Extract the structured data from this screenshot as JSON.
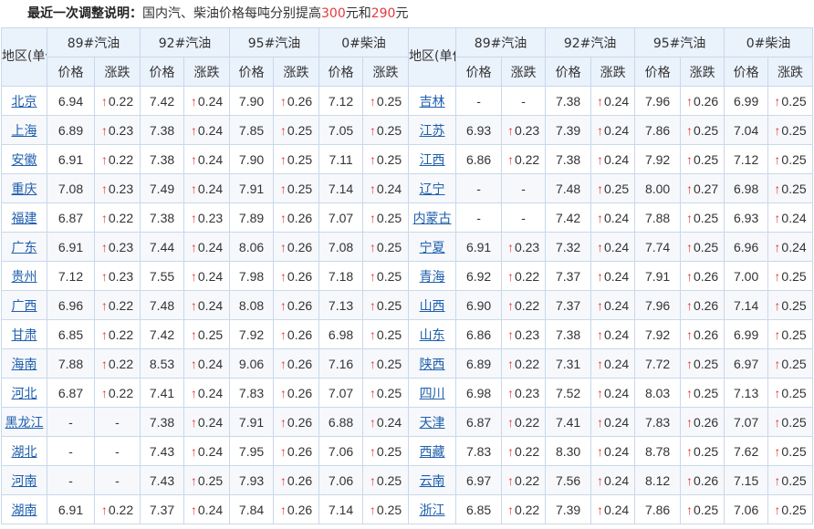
{
  "notice": {
    "label": "最近一次调整说明：",
    "text_pre": "国内汽、柴油价格每吨分别提高",
    "gas_amount": "300",
    "text_mid": "元和",
    "diesel_amount": "290",
    "text_post": "元"
  },
  "header": {
    "region": "地区(单位:元/升)",
    "fuels": [
      "89#汽油",
      "92#汽油",
      "95#汽油",
      "0#柴油"
    ],
    "price": "价格",
    "change": "涨跌",
    "up_arrow": "↑",
    "none": "-"
  },
  "rows": [
    {
      "left": {
        "region": "北京",
        "v": [
          [
            "6.94",
            "0.22"
          ],
          [
            "7.42",
            "0.24"
          ],
          [
            "7.90",
            "0.26"
          ],
          [
            "7.12",
            "0.25"
          ]
        ]
      },
      "right": {
        "region": "吉林",
        "v": [
          [
            "-",
            "-"
          ],
          [
            "7.38",
            "0.24"
          ],
          [
            "7.96",
            "0.26"
          ],
          [
            "6.99",
            "0.25"
          ]
        ]
      }
    },
    {
      "left": {
        "region": "上海",
        "v": [
          [
            "6.89",
            "0.23"
          ],
          [
            "7.38",
            "0.24"
          ],
          [
            "7.85",
            "0.25"
          ],
          [
            "7.05",
            "0.25"
          ]
        ]
      },
      "right": {
        "region": "江苏",
        "v": [
          [
            "6.93",
            "0.23"
          ],
          [
            "7.39",
            "0.24"
          ],
          [
            "7.86",
            "0.25"
          ],
          [
            "7.04",
            "0.25"
          ]
        ]
      }
    },
    {
      "left": {
        "region": "安徽",
        "v": [
          [
            "6.91",
            "0.22"
          ],
          [
            "7.38",
            "0.24"
          ],
          [
            "7.90",
            "0.25"
          ],
          [
            "7.11",
            "0.25"
          ]
        ]
      },
      "right": {
        "region": "江西",
        "v": [
          [
            "6.86",
            "0.22"
          ],
          [
            "7.38",
            "0.24"
          ],
          [
            "7.92",
            "0.25"
          ],
          [
            "7.12",
            "0.25"
          ]
        ]
      }
    },
    {
      "left": {
        "region": "重庆",
        "v": [
          [
            "7.08",
            "0.23"
          ],
          [
            "7.49",
            "0.24"
          ],
          [
            "7.91",
            "0.25"
          ],
          [
            "7.14",
            "0.24"
          ]
        ]
      },
      "right": {
        "region": "辽宁",
        "v": [
          [
            "-",
            "-"
          ],
          [
            "7.48",
            "0.25"
          ],
          [
            "8.00",
            "0.27"
          ],
          [
            "6.98",
            "0.25"
          ]
        ]
      }
    },
    {
      "left": {
        "region": "福建",
        "v": [
          [
            "6.87",
            "0.22"
          ],
          [
            "7.38",
            "0.23"
          ],
          [
            "7.89",
            "0.26"
          ],
          [
            "7.07",
            "0.25"
          ]
        ]
      },
      "right": {
        "region": "内蒙古",
        "v": [
          [
            "-",
            "-"
          ],
          [
            "7.42",
            "0.24"
          ],
          [
            "7.88",
            "0.25"
          ],
          [
            "6.93",
            "0.24"
          ]
        ]
      }
    },
    {
      "left": {
        "region": "广东",
        "v": [
          [
            "6.91",
            "0.23"
          ],
          [
            "7.44",
            "0.24"
          ],
          [
            "8.06",
            "0.26"
          ],
          [
            "7.08",
            "0.25"
          ]
        ]
      },
      "right": {
        "region": "宁夏",
        "v": [
          [
            "6.91",
            "0.23"
          ],
          [
            "7.32",
            "0.24"
          ],
          [
            "7.74",
            "0.25"
          ],
          [
            "6.96",
            "0.24"
          ]
        ]
      }
    },
    {
      "left": {
        "region": "贵州",
        "v": [
          [
            "7.12",
            "0.23"
          ],
          [
            "7.55",
            "0.24"
          ],
          [
            "7.98",
            "0.26"
          ],
          [
            "7.18",
            "0.25"
          ]
        ]
      },
      "right": {
        "region": "青海",
        "v": [
          [
            "6.92",
            "0.22"
          ],
          [
            "7.37",
            "0.24"
          ],
          [
            "7.91",
            "0.26"
          ],
          [
            "7.00",
            "0.25"
          ]
        ]
      }
    },
    {
      "left": {
        "region": "广西",
        "v": [
          [
            "6.96",
            "0.22"
          ],
          [
            "7.48",
            "0.24"
          ],
          [
            "8.08",
            "0.26"
          ],
          [
            "7.13",
            "0.25"
          ]
        ]
      },
      "right": {
        "region": "山西",
        "v": [
          [
            "6.90",
            "0.22"
          ],
          [
            "7.37",
            "0.24"
          ],
          [
            "7.96",
            "0.26"
          ],
          [
            "7.14",
            "0.25"
          ]
        ]
      }
    },
    {
      "left": {
        "region": "甘肃",
        "v": [
          [
            "6.85",
            "0.22"
          ],
          [
            "7.42",
            "0.25"
          ],
          [
            "7.92",
            "0.26"
          ],
          [
            "6.98",
            "0.25"
          ]
        ]
      },
      "right": {
        "region": "山东",
        "v": [
          [
            "6.86",
            "0.23"
          ],
          [
            "7.38",
            "0.24"
          ],
          [
            "7.92",
            "0.26"
          ],
          [
            "6.99",
            "0.25"
          ]
        ]
      }
    },
    {
      "left": {
        "region": "海南",
        "v": [
          [
            "7.88",
            "0.22"
          ],
          [
            "8.53",
            "0.24"
          ],
          [
            "9.06",
            "0.26"
          ],
          [
            "7.16",
            "0.25"
          ]
        ]
      },
      "right": {
        "region": "陕西",
        "v": [
          [
            "6.89",
            "0.22"
          ],
          [
            "7.31",
            "0.24"
          ],
          [
            "7.72",
            "0.25"
          ],
          [
            "6.97",
            "0.25"
          ]
        ]
      }
    },
    {
      "left": {
        "region": "河北",
        "v": [
          [
            "6.87",
            "0.22"
          ],
          [
            "7.41",
            "0.24"
          ],
          [
            "7.83",
            "0.26"
          ],
          [
            "7.07",
            "0.25"
          ]
        ]
      },
      "right": {
        "region": "四川",
        "v": [
          [
            "6.98",
            "0.23"
          ],
          [
            "7.52",
            "0.24"
          ],
          [
            "8.03",
            "0.25"
          ],
          [
            "7.13",
            "0.25"
          ]
        ]
      }
    },
    {
      "left": {
        "region": "黑龙江",
        "v": [
          [
            "-",
            "-"
          ],
          [
            "7.38",
            "0.24"
          ],
          [
            "7.91",
            "0.26"
          ],
          [
            "6.88",
            "0.24"
          ]
        ]
      },
      "right": {
        "region": "天津",
        "v": [
          [
            "6.87",
            "0.22"
          ],
          [
            "7.41",
            "0.24"
          ],
          [
            "7.83",
            "0.26"
          ],
          [
            "7.07",
            "0.25"
          ]
        ]
      }
    },
    {
      "left": {
        "region": "湖北",
        "v": [
          [
            "-",
            "-"
          ],
          [
            "7.43",
            "0.24"
          ],
          [
            "7.95",
            "0.26"
          ],
          [
            "7.06",
            "0.25"
          ]
        ]
      },
      "right": {
        "region": "西藏",
        "v": [
          [
            "7.83",
            "0.22"
          ],
          [
            "8.30",
            "0.24"
          ],
          [
            "8.78",
            "0.25"
          ],
          [
            "7.62",
            "0.25"
          ]
        ]
      }
    },
    {
      "left": {
        "region": "河南",
        "v": [
          [
            "-",
            "-"
          ],
          [
            "7.43",
            "0.25"
          ],
          [
            "7.93",
            "0.26"
          ],
          [
            "7.06",
            "0.25"
          ]
        ]
      },
      "right": {
        "region": "云南",
        "v": [
          [
            "6.97",
            "0.22"
          ],
          [
            "7.56",
            "0.24"
          ],
          [
            "8.12",
            "0.26"
          ],
          [
            "7.15",
            "0.25"
          ]
        ]
      }
    },
    {
      "left": {
        "region": "湖南",
        "v": [
          [
            "6.91",
            "0.22"
          ],
          [
            "7.37",
            "0.24"
          ],
          [
            "7.84",
            "0.26"
          ],
          [
            "7.14",
            "0.25"
          ]
        ]
      },
      "right": {
        "region": "浙江",
        "v": [
          [
            "6.85",
            "0.22"
          ],
          [
            "7.39",
            "0.24"
          ],
          [
            "7.86",
            "0.25"
          ],
          [
            "7.06",
            "0.25"
          ]
        ]
      }
    }
  ]
}
